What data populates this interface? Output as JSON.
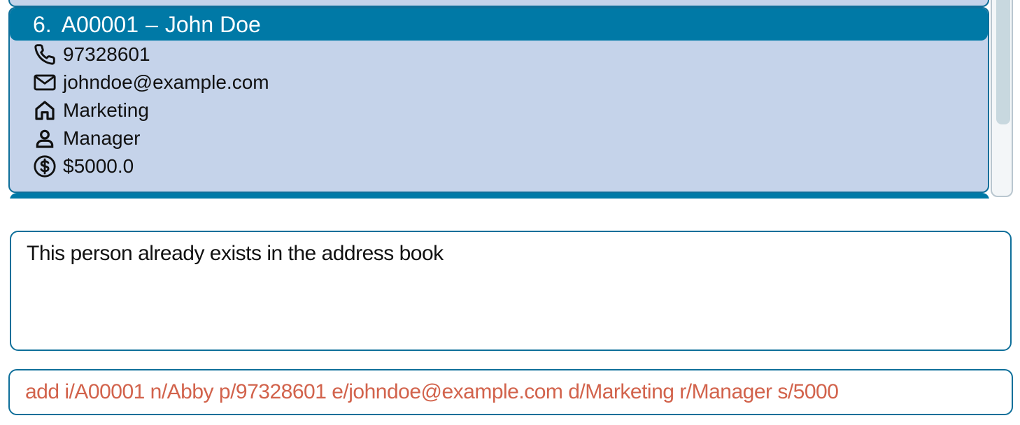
{
  "person_list": {
    "selected_card": {
      "index": "6.",
      "id": "A00001",
      "separator": "–",
      "name": "John Doe",
      "phone": "97328601",
      "email": "johndoe@example.com",
      "department": "Marketing",
      "role": "Manager",
      "salary": "$5000.0"
    },
    "icons": {
      "phone": "phone-icon",
      "email": "envelope-icon",
      "department": "house-icon",
      "role": "person-icon",
      "salary": "dollar-circle-icon"
    }
  },
  "result_display": {
    "message": "This person already exists in the address book"
  },
  "command_box": {
    "value": "add i/A00001 n/Abby p/97328601 e/johndoe@example.com d/Marketing r/Manager s/5000",
    "text_color": "#d2634c"
  },
  "colors": {
    "card_background": "#c5d3ea",
    "card_header": "#0079a6",
    "border": "#0e6f9a"
  }
}
